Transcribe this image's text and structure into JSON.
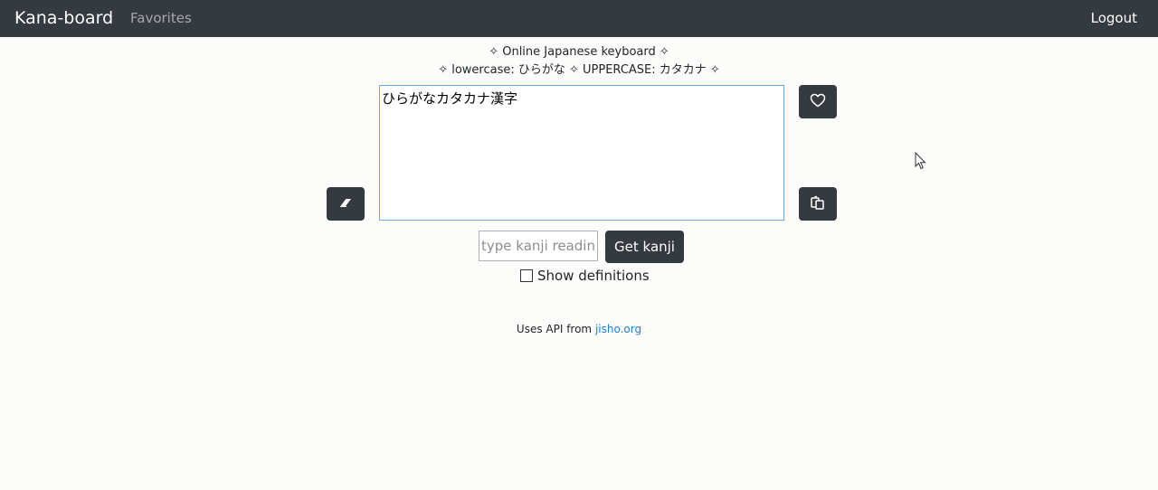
{
  "navbar": {
    "brand": "Kana-board",
    "favorites": "Favorites",
    "logout": "Logout"
  },
  "header": {
    "line1": "✧ Online Japanese keyboard ✧",
    "line2": "✧ lowercase: ひらがな ✧ UPPERCASE: カタカナ ✧"
  },
  "editor": {
    "value": "ひらがなカタカナ漢字"
  },
  "kanji": {
    "placeholder": "type kanji reading",
    "value": "",
    "button": "Get kanji"
  },
  "definitions": {
    "label": "Show definitions",
    "checked": false
  },
  "footer": {
    "text": "Uses API from ",
    "link": "jisho.org"
  },
  "icons": {
    "clear": "eraser-icon",
    "favorite": "heart-icon",
    "copy": "copy-icon"
  },
  "colors": {
    "navbar": "#343a40",
    "button": "#343a40",
    "link": "#1d7fd6",
    "textarea_border": "#6ea8de"
  }
}
